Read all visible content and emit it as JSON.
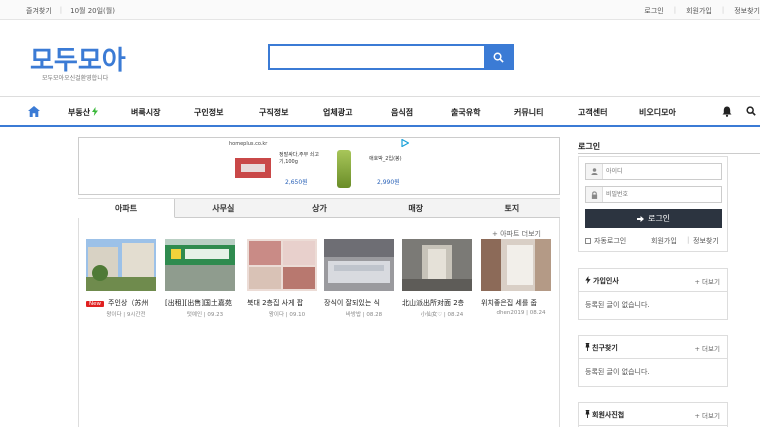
{
  "topbar": {
    "bookmark": "즐겨찾기",
    "date": "10월 20일(월)",
    "login": "로그인",
    "signup": "회원가입",
    "find_info": "정보찾기"
  },
  "header": {
    "logo": "모두모아",
    "logo_sub": "모두모아오신걸환영합니다",
    "search_value": ""
  },
  "nav": {
    "items": [
      "부동산",
      "벼룩시장",
      "구인정보",
      "구직정보",
      "업체광고",
      "음식점",
      "출국유학",
      "커뮤니티",
      "고객센터",
      "비오디모아"
    ]
  },
  "ad": {
    "source": "homeplus.co.kr",
    "product1_name": "정말싸다,주부 쇠고기,100g",
    "product1_price": "2,650원",
    "product2_name": "애호박_2입(봉)",
    "product2_price": "2,990원"
  },
  "tabs": [
    "아파트",
    "사무실",
    "상가",
    "매장",
    "토지"
  ],
  "panel": {
    "more": "+ 아파트 더보기",
    "new_badge": "New",
    "cards": [
      {
        "title": "주인상（苏州",
        "author": "왕이다",
        "date": "9시간전",
        "new": true
      },
      {
        "title": "[出租][出售]国土嘉苑",
        "author": "텃예인",
        "date": "09.23",
        "new": false
      },
      {
        "title": "북대 2층집 사게 팝",
        "author": "왕이다",
        "date": "09.10",
        "new": false
      },
      {
        "title": "장식이 잘되있는 식",
        "author": "바방밥",
        "date": "08.28",
        "new": false
      },
      {
        "title": "北山派出所对面 2층",
        "author": "小仙女♡",
        "date": "08.24",
        "new": false
      },
      {
        "title": "위치좋은집 세를 줍",
        "author": "dhen2019",
        "date": "08.24",
        "new": false
      }
    ]
  },
  "login": {
    "title": "로그인",
    "id_placeholder": "아이디",
    "pw_placeholder": "비밀번호",
    "button": "로그인",
    "auto_login": "자동로그인",
    "signup": "회원가입",
    "find": "정보찾기"
  },
  "widgets": [
    {
      "title": "가입인사",
      "more": "+ 더보기",
      "empty": "등록된 글이 없습니다."
    },
    {
      "title": "친구찾기",
      "more": "+ 더보기",
      "empty": "등록된 글이 없습니다."
    },
    {
      "title": "회원사진첩",
      "more": "+ 더보기",
      "empty": ""
    }
  ],
  "colors": {
    "brand": "#3b7bd5",
    "dark_button": "#2c3440",
    "new_badge": "#e02020"
  }
}
